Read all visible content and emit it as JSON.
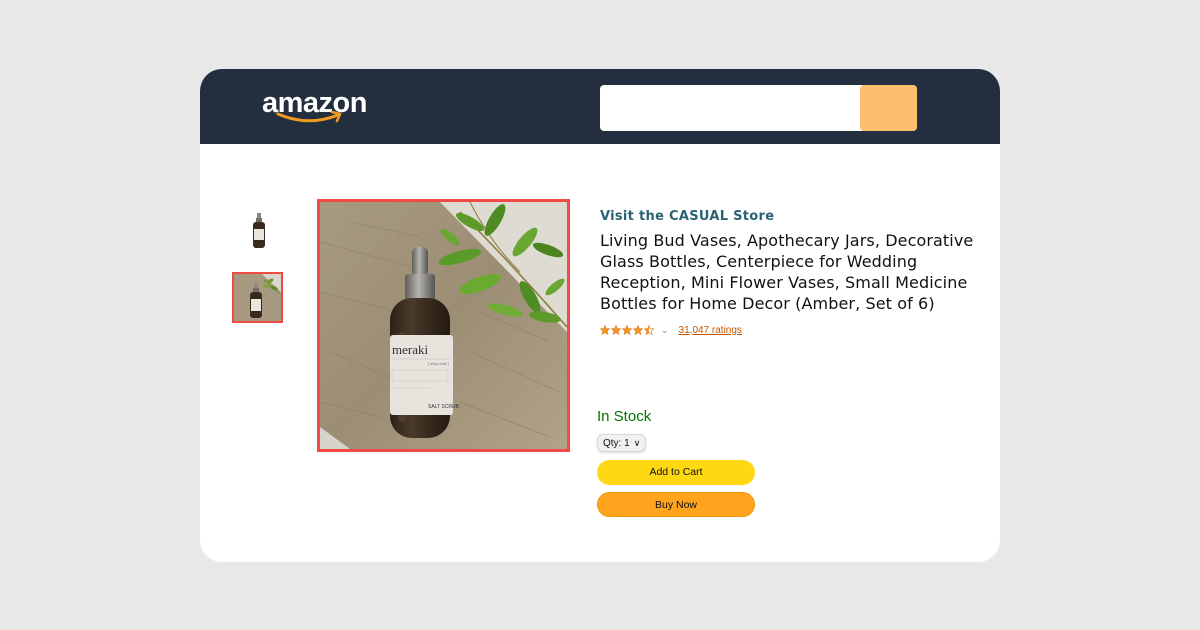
{
  "header": {
    "logo_text": "amazon",
    "search": {
      "value": "",
      "placeholder": ""
    },
    "search_button_color": "#fcbf6e",
    "background_color": "#232f3e"
  },
  "gallery": {
    "thumbnails": [
      {
        "alt": "Amber dropper bottle (meraki)",
        "selected": false
      },
      {
        "alt": "Amber dropper bottle on stone with leaves",
        "selected": true
      }
    ],
    "main_image": {
      "alt": "Amber dropper bottle labeled meraki on stone slab with green leaves",
      "label_brand": "meraki",
      "label_variant": "[ silky mist ]",
      "label_product": "SALT SCRUB"
    },
    "selection_color": "#f04a45"
  },
  "product": {
    "store_link": "Visit the CASUAL Store",
    "title": "Living Bud Vases, Apothecary Jars, Decorative Glass Bottles, Centerpiece for Wedding Reception, Mini Flower Vases, Small Medicine Bottles for Home Decor (Amber, Set of 6)",
    "rating": 4.5,
    "rating_max": 5,
    "ratings_count": "31,047 ratings"
  },
  "buybox": {
    "stock_status": "In Stock",
    "qty_label": "Qty:",
    "qty_value": "1",
    "add_to_cart": "Add to Cart",
    "buy_now": "Buy Now"
  }
}
